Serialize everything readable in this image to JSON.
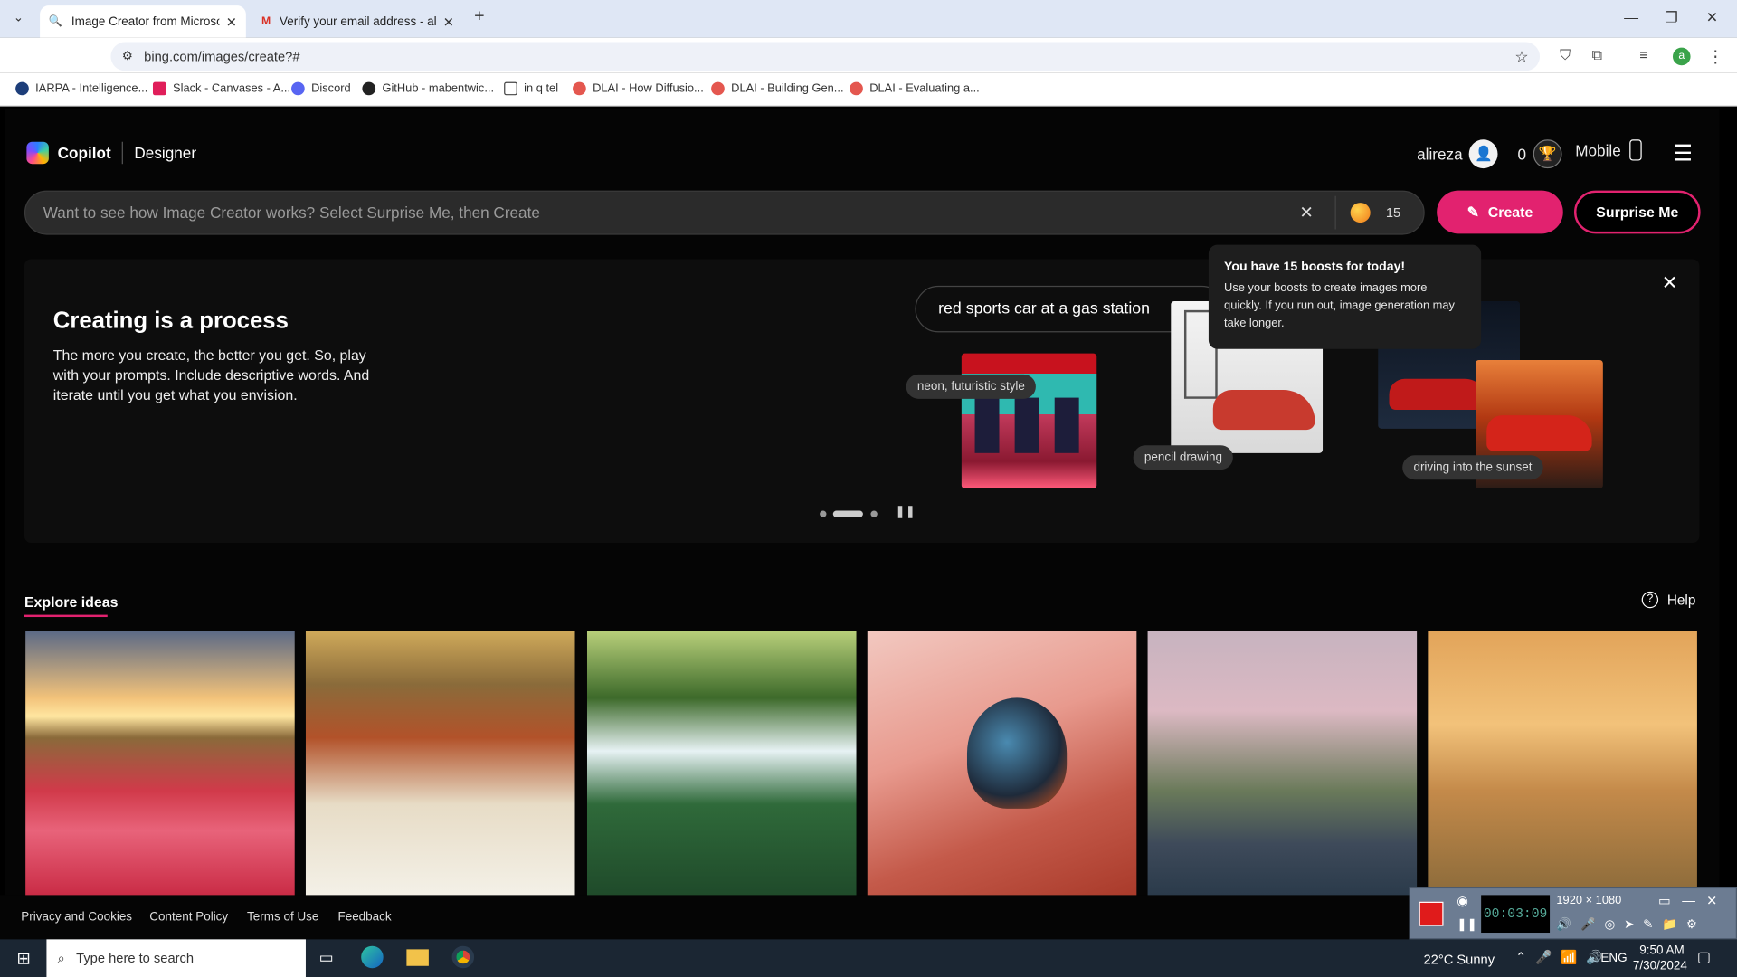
{
  "browser": {
    "tabs": [
      {
        "title": "Image Creator from Microsoft D",
        "active": true
      },
      {
        "title": "Verify your email address - alire",
        "active": false
      }
    ],
    "url": "bing.com/images/create?#",
    "bookmarks": [
      "IARPA - Intelligence...",
      "Slack - Canvases - A...",
      "Discord",
      "GitHub - mabentwic...",
      "in q tel",
      "DLAI - How Diffusio...",
      "DLAI - Building Gen...",
      "DLAI - Evaluating a..."
    ]
  },
  "header": {
    "brand": "Copilot",
    "section": "Designer",
    "user": "alireza",
    "points": "0",
    "mobile_label": "Mobile"
  },
  "search": {
    "placeholder": "Want to see how Image Creator works? Select Surprise Me, then Create",
    "boost_count": "15"
  },
  "buttons": {
    "create": "Create",
    "surprise": "Surprise Me"
  },
  "hero": {
    "title": "Creating is a process",
    "body": "The more you create, the better you get. So, play with your prompts. Include descriptive words. And iterate until you get what you envision.",
    "prompt": "red sports car at a gas station",
    "tags": [
      "neon, futuristic style",
      "pencil drawing",
      "driving into the sunset"
    ]
  },
  "tooltip": {
    "title": "You have 15 boosts for today!",
    "body": "Use your boosts to create images more quickly. If you run out, image generation may take longer."
  },
  "explore": {
    "title": "Explore ideas",
    "help": "Help"
  },
  "footer": {
    "links": [
      "Privacy and Cookies",
      "Content Policy",
      "Terms of Use",
      "Feedback"
    ]
  },
  "recorder": {
    "resolution": "1920 × 1080",
    "timer": "00:03:09"
  },
  "taskbar": {
    "search_placeholder": "Type here to search",
    "weather": "22°C  Sunny",
    "lang": "ENG",
    "time": "9:50 AM",
    "date": "7/30/2024"
  }
}
